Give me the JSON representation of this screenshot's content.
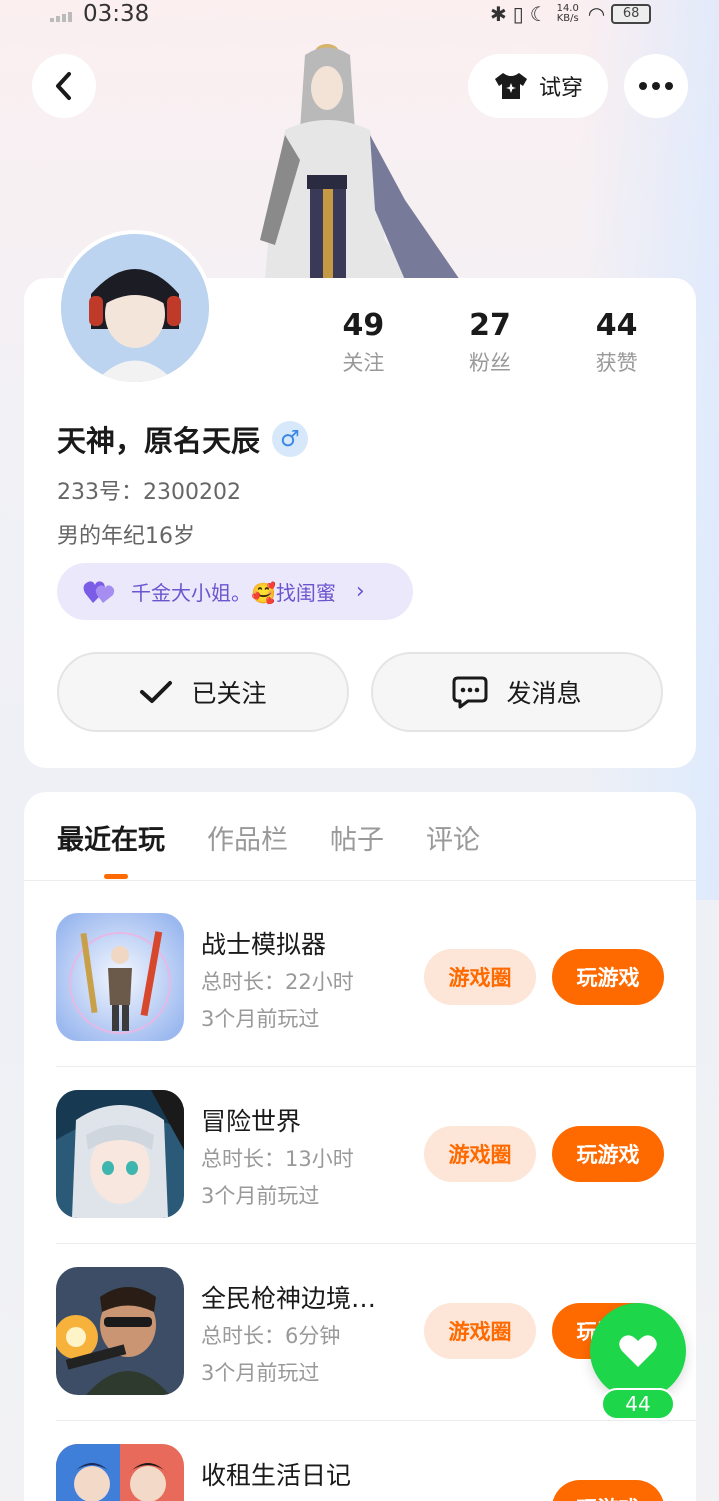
{
  "status_bar": {
    "time": "03:38",
    "net_speed_top": "14.0",
    "net_speed_unit": "KB/s",
    "battery": "68"
  },
  "header": {
    "try_on_label": "试穿"
  },
  "profile": {
    "name": "天神，原名天辰",
    "gender_symbol": "♂",
    "uid": "233号：2300202",
    "bio": "男的年纪16岁",
    "tag": "千金大小姐。🥰找闺蜜",
    "stats": [
      {
        "num": "49",
        "label": "关注"
      },
      {
        "num": "27",
        "label": "粉丝"
      },
      {
        "num": "44",
        "label": "获赞"
      }
    ],
    "followed_label": "已关注",
    "message_label": "发消息"
  },
  "tabs": [
    "最近在玩",
    "作品栏",
    "帖子",
    "评论"
  ],
  "games": [
    {
      "name": "战士模拟器",
      "duration": "总时长：22小时",
      "last_played": "3个月前玩过",
      "circle": "游戏圈",
      "play": "玩游戏"
    },
    {
      "name": "冒险世界",
      "duration": "总时长：13小时",
      "last_played": "3个月前玩过",
      "circle": "游戏圈",
      "play": "玩游戏"
    },
    {
      "name": "全民枪神边境…",
      "duration": "总时长：6分钟",
      "last_played": "3个月前玩过",
      "circle": "游戏圈",
      "play": "玩游戏"
    },
    {
      "name": "收租生活日记",
      "duration": "",
      "last_played": "",
      "circle": "",
      "play": "玩游戏"
    }
  ],
  "like_fab": {
    "count": "44"
  },
  "colors": {
    "accent": "#ff6a00",
    "like_green": "#1ed64a",
    "tag_purple": "#6b55cf"
  }
}
